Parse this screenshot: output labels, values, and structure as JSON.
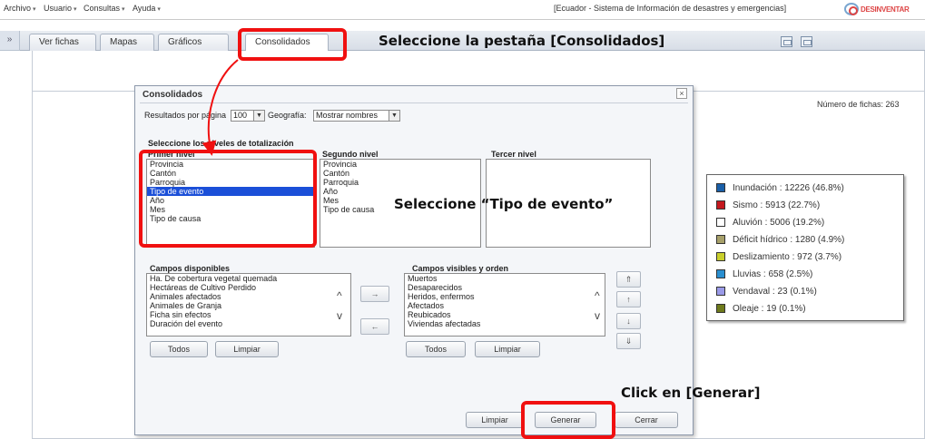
{
  "menubar": {
    "items": [
      {
        "label": "Archivo",
        "icon": "caret-down-icon"
      },
      {
        "label": "Usuario",
        "icon": "caret-down-icon"
      },
      {
        "label": "Consultas",
        "icon": "caret-down-icon"
      },
      {
        "label": "Ayuda",
        "icon": "caret-down-icon"
      }
    ],
    "app_title": "[Ecuador - Sistema de Información de desastres y emergencias]",
    "logo_text": "DESINVENTAR"
  },
  "tabs": [
    {
      "label": "Ver fichas"
    },
    {
      "label": "Mapas"
    },
    {
      "label": "Gráficos"
    },
    {
      "label": "Consolidados"
    }
  ],
  "toolbar": {
    "icons": [
      "save-icon",
      "print-icon"
    ]
  },
  "sidebar_toggle": "»",
  "record_count": "Número de fichas: 263",
  "dialog": {
    "title": "Consolidados",
    "close_label": "×",
    "results_per_page_label": "Resultados por página",
    "results_per_page_value": "100",
    "geography_label": "Geografía:",
    "geography_value": "Mostrar nombres",
    "levels_title": "Seleccione los niveles de totalización",
    "first_level": {
      "title": "Primer nivel",
      "items": [
        "Provincia",
        "Cantón",
        "Parroquia",
        "Tipo de evento",
        "Año",
        "Mes",
        "Tipo de causa"
      ],
      "selected": "Tipo de evento"
    },
    "second_level": {
      "title": "Segundo nivel",
      "items": [
        "Provincia",
        "Cantón",
        "Parroquia",
        "Año",
        "Mes",
        "Tipo de causa"
      ]
    },
    "third_level": {
      "title": "Tercer nivel",
      "items": []
    },
    "available_fields": {
      "title": "Campos disponibles",
      "items": [
        "Ha. De cobertura vegetal quemada",
        "Hectáreas de Cultivo Perdido",
        "Animales afectados",
        "Animales de Granja",
        "Ficha sin efectos",
        "Duración del evento"
      ],
      "all_label": "Todos",
      "clear_label": "Limpiar"
    },
    "visible_fields": {
      "title": "Campos visibles y orden",
      "items": [
        "Muertos",
        "Desaparecidos",
        "Heridos, enfermos",
        "Afectados",
        "Reubicados",
        "Viviendas afectadas"
      ],
      "all_label": "Todos",
      "clear_label": "Limpiar"
    },
    "move_right": "→",
    "move_left": "←",
    "order_buttons": [
      "⇑",
      "↑",
      "↓",
      "⇓"
    ],
    "footer": {
      "clear_label": "Limpiar",
      "generate_label": "Generar",
      "close_label": "Cerrar"
    }
  },
  "legend": {
    "items": [
      {
        "label": "Inundación : 12226 (46.8%)",
        "color": "#1a5fa8"
      },
      {
        "label": "Sismo : 5913 (22.7%)",
        "color": "#c4181e"
      },
      {
        "label": "Aluvión : 5006 (19.2%)",
        "color": "#ffffff"
      },
      {
        "label": "Déficit hídrico : 1280 (4.9%)",
        "color": "#a7a06a"
      },
      {
        "label": "Deslizamiento : 972 (3.7%)",
        "color": "#c9cf2c"
      },
      {
        "label": "Lluvias : 658 (2.5%)",
        "color": "#2a8fd0"
      },
      {
        "label": "Vendaval : 23 (0.1%)",
        "color": "#9a9ae8"
      },
      {
        "label": "Oleaje : 19 (0.1%)",
        "color": "#6e7a1c"
      }
    ]
  },
  "annotations": {
    "tab_instruction": "Seleccione la pestaña [Consolidados]",
    "select_instruction": "Seleccione “Tipo de evento”",
    "click_instruction": "Click en [Generar]"
  },
  "colors": {
    "callout": "#f01010",
    "selection": "#1b4fd8"
  }
}
